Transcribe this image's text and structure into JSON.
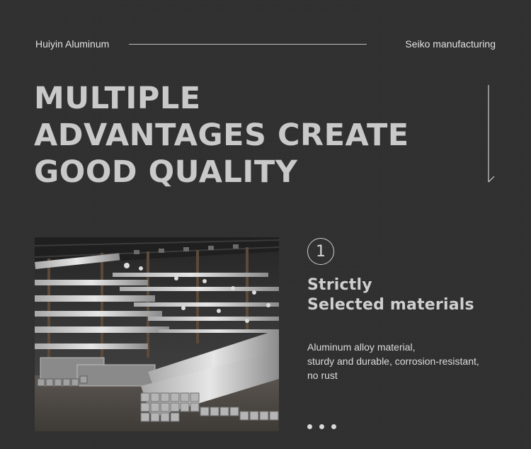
{
  "header": {
    "brand": "Huiyin Aluminum",
    "tagline": "Seiko manufacturing"
  },
  "headline": {
    "lines": [
      "MULTIPLE",
      "ADVANTAGES CREATE",
      "GOOD QUALITY"
    ]
  },
  "feature": {
    "number": "1",
    "title_lines": [
      "Strictly",
      "Selected materials"
    ],
    "description_lines": [
      "Aluminum alloy material,",
      "sturdy and durable, corrosion-resistant,",
      "no rust"
    ]
  },
  "carousel": {
    "dot_count": 3
  },
  "colors": {
    "background": "#2f2f2f",
    "text": "#d4d4d4",
    "headline": "#c9c9c9"
  },
  "icons": {
    "scroll": "down-arrow-line-icon",
    "photo": "warehouse-aluminum-profiles-photo"
  }
}
